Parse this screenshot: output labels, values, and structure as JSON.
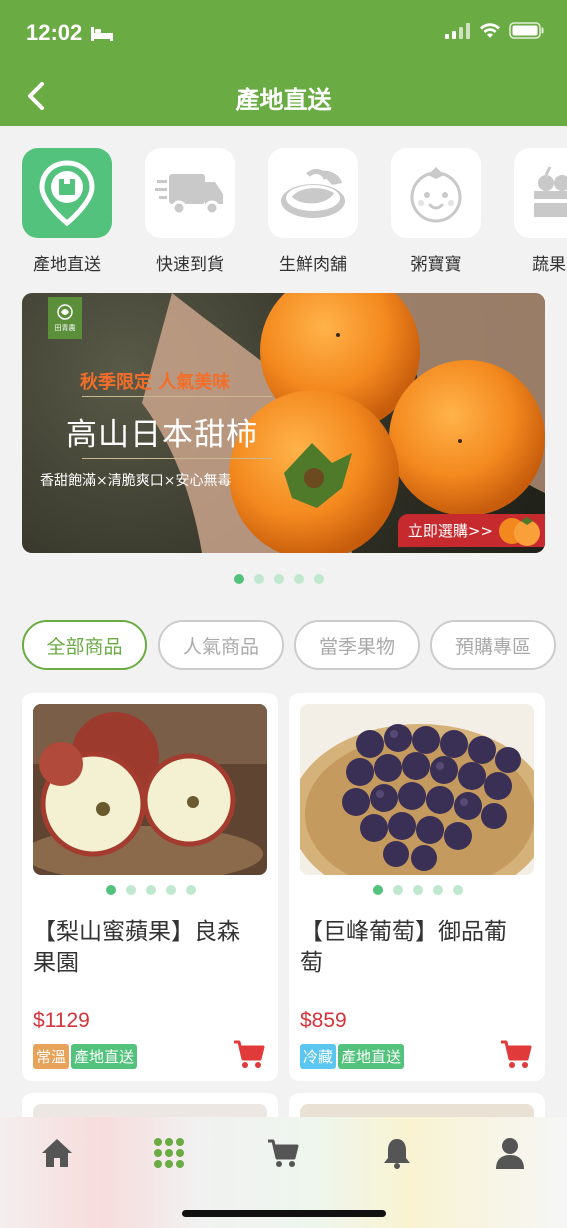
{
  "status_bar": {
    "time": "12:02"
  },
  "header": {
    "title": "產地直送"
  },
  "categories": [
    {
      "label": "產地直送",
      "icon": "location-pin-icon"
    },
    {
      "label": "快速到貨",
      "icon": "truck-icon"
    },
    {
      "label": "生鮮肉舖",
      "icon": "meat-icon"
    },
    {
      "label": "粥寶寶",
      "icon": "baby-face-icon"
    },
    {
      "label": "蔬果",
      "icon": "vegetable-basket-icon"
    }
  ],
  "banner": {
    "logo_text": "田青農",
    "subtitle": "秋季限定 人氣美味",
    "title": "高山日本甜柿",
    "description": "香甜飽滿×清脆爽口×安心無毒",
    "cta": "立即選購>>",
    "slide_count": 5,
    "active_slide": 1
  },
  "tabs": [
    {
      "label": "全部商品",
      "active": true
    },
    {
      "label": "人氣商品",
      "active": false
    },
    {
      "label": "當季果物",
      "active": false
    },
    {
      "label": "預購專區",
      "active": false
    }
  ],
  "products": [
    {
      "name": "【梨山蜜蘋果】良森果園",
      "price": "$1129",
      "tags": [
        "常溫",
        "產地直送"
      ],
      "image_count": 5,
      "active_image": 1
    },
    {
      "name": "【巨峰葡萄】御品葡萄",
      "price": "$859",
      "tags": [
        "冷藏",
        "產地直送"
      ],
      "image_count": 5,
      "active_image": 1
    }
  ],
  "colors": {
    "brand_green": "#6bab44",
    "accent_green": "#52c27c",
    "price_red": "#d6333a",
    "tag_orange": "#e8a35a",
    "tag_green": "#52c27c",
    "tag_blue": "#5bc6f0"
  },
  "bottom_nav": [
    {
      "icon": "home-icon"
    },
    {
      "icon": "grid-icon"
    },
    {
      "icon": "cart-icon"
    },
    {
      "icon": "bell-icon"
    },
    {
      "icon": "user-icon"
    }
  ]
}
